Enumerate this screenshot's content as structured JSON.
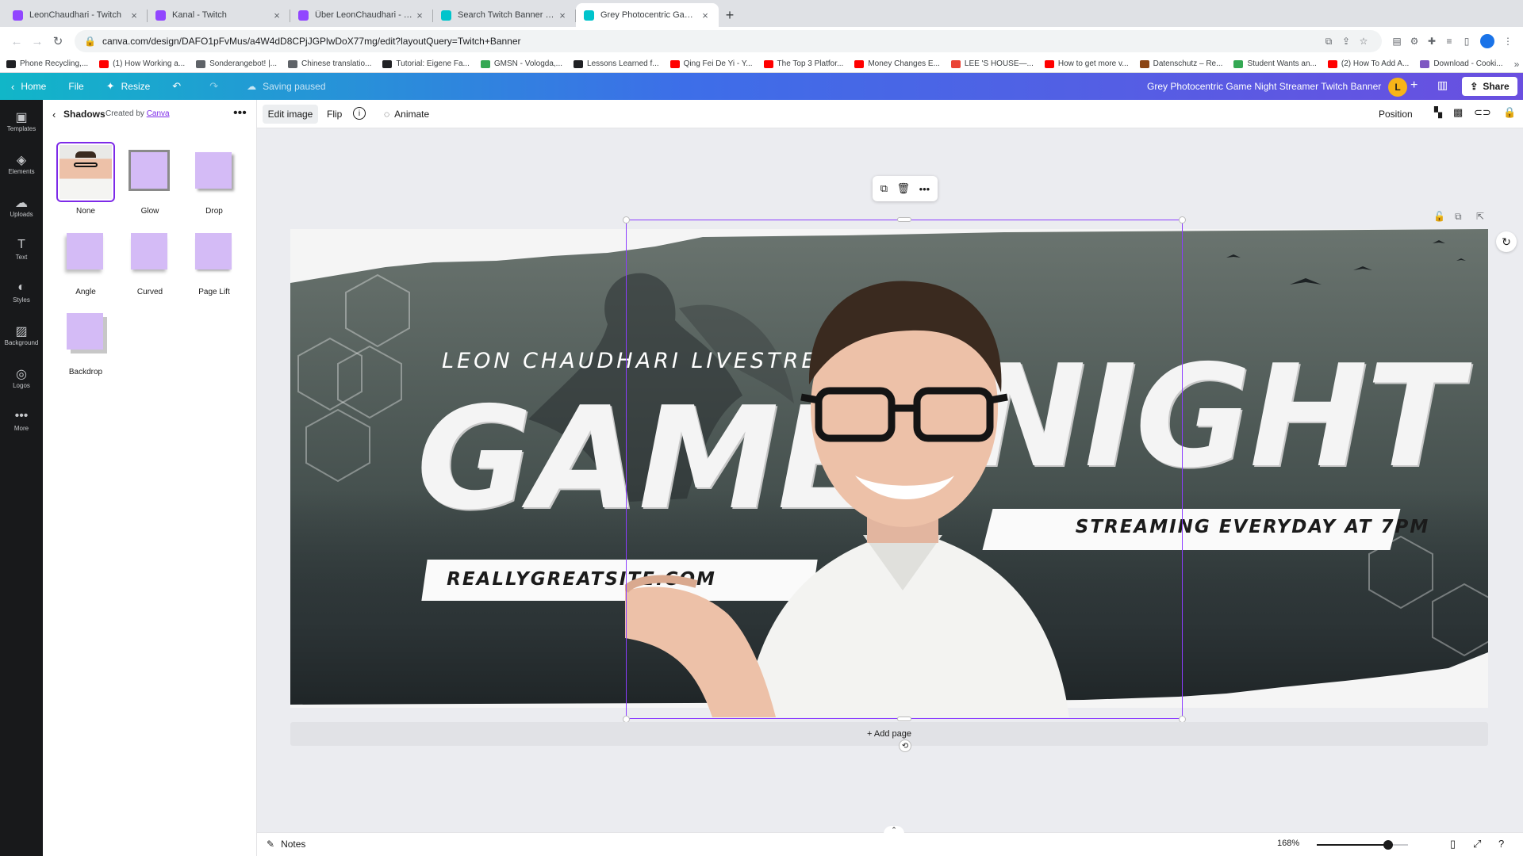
{
  "browser": {
    "tabs": [
      {
        "title": "LeonChaudhari - Twitch",
        "icon_color": "#9146ff",
        "active": false
      },
      {
        "title": "Kanal - Twitch",
        "icon_color": "#9146ff",
        "active": false
      },
      {
        "title": "Über LeonChaudhari - Twitch",
        "icon_color": "#9146ff",
        "active": false
      },
      {
        "title": "Search Twitch Banner - Canva",
        "icon_color": "#00c4cc",
        "active": false
      },
      {
        "title": "Grey Photocentric Game Night",
        "icon_color": "#00c4cc",
        "active": true
      }
    ],
    "url": "canva.com/design/DAFO1pFvMus/a4W4dD8CPjJGPlwDoX77mg/edit?layoutQuery=Twitch+Banner",
    "bookmarks": [
      {
        "label": "Phone Recycling,...",
        "color": "#202124"
      },
      {
        "label": "(1) How Working a...",
        "color": "#ff0000"
      },
      {
        "label": "Sonderangebot! |...",
        "color": "#5f6368"
      },
      {
        "label": "Chinese translatio...",
        "color": "#5f6368"
      },
      {
        "label": "Tutorial: Eigene Fa...",
        "color": "#202124"
      },
      {
        "label": "GMSN - Vologda,...",
        "color": "#34a853"
      },
      {
        "label": "Lessons Learned f...",
        "color": "#202124"
      },
      {
        "label": "Qing Fei De Yi - Y...",
        "color": "#ff0000"
      },
      {
        "label": "The Top 3 Platfor...",
        "color": "#ff0000"
      },
      {
        "label": "Money Changes E...",
        "color": "#ff0000"
      },
      {
        "label": "LEE 'S HOUSE—...",
        "color": "#ea4335"
      },
      {
        "label": "How to get more v...",
        "color": "#ff0000"
      },
      {
        "label": "Datenschutz – Re...",
        "color": "#8b4513"
      },
      {
        "label": "Student Wants an...",
        "color": "#34a853"
      },
      {
        "label": "(2) How To Add A...",
        "color": "#ff0000"
      },
      {
        "label": "Download - Cooki...",
        "color": "#7e57c2"
      }
    ],
    "bookmarks_more": "»"
  },
  "canva_header": {
    "home": "Home",
    "file": "File",
    "resize": "Resize",
    "saving": "Saving paused",
    "design_title": "Grey Photocentric Game Night Streamer Twitch Banner",
    "avatar_letter": "L",
    "share": "Share"
  },
  "rail": [
    {
      "label": "Templates",
      "icon": "▣"
    },
    {
      "label": "Elements",
      "icon": "◈"
    },
    {
      "label": "Uploads",
      "icon": "☁"
    },
    {
      "label": "Text",
      "icon": "T"
    },
    {
      "label": "Styles",
      "icon": "◐"
    },
    {
      "label": "Background",
      "icon": "▨"
    },
    {
      "label": "Logos",
      "icon": "◎"
    },
    {
      "label": "More",
      "icon": "•••"
    }
  ],
  "panel": {
    "title": "Shadows",
    "created_by": "Created by",
    "creator": "Canva",
    "options": [
      {
        "label": "None",
        "selected": true
      },
      {
        "label": "Glow",
        "selected": false
      },
      {
        "label": "Drop",
        "selected": false
      },
      {
        "label": "Angle",
        "selected": false
      },
      {
        "label": "Curved",
        "selected": false
      },
      {
        "label": "Page Lift",
        "selected": false
      },
      {
        "label": "Backdrop",
        "selected": false
      }
    ]
  },
  "toolbar": {
    "edit_image": "Edit image",
    "flip": "Flip",
    "info": "i",
    "animate": "Animate",
    "position": "Position"
  },
  "banner": {
    "livestream": "LEON CHAUDHARI LIVESTREAM",
    "game": "GAME",
    "night": "NIGHT",
    "streaming": "STREAMING EVERYDAY AT 7PM",
    "site": "REALLYGREATSITE.COM"
  },
  "add_page": "+ Add page",
  "footer": {
    "notes": "Notes",
    "zoom": "168%",
    "zoom_level": 0.78
  }
}
